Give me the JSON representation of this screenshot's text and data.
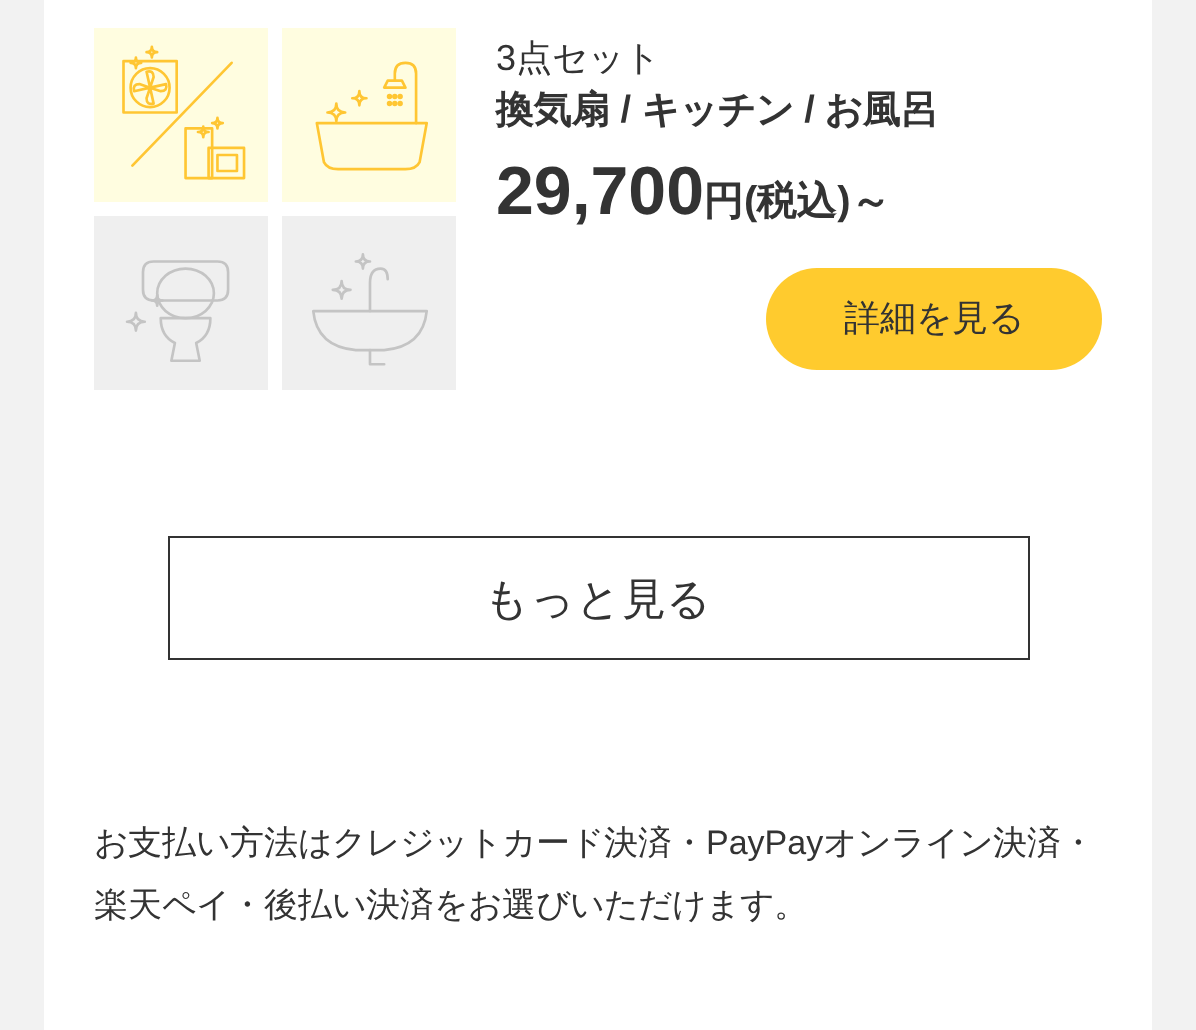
{
  "plan": {
    "tiles": [
      {
        "kind": "fan-kitchen",
        "included": true
      },
      {
        "kind": "bath",
        "included": true
      },
      {
        "kind": "toilet",
        "included": false
      },
      {
        "kind": "sink",
        "included": false
      }
    ],
    "set_label": "3点セット",
    "title": "換気扇 / キッチン / お風呂",
    "price": "29,700",
    "currency": "円",
    "tax_note": "(税込)～",
    "detail_button": "詳細を見る"
  },
  "more_button": "もっと見る",
  "payment_note": "お支払い方法はクレジットカード決済・PayPayオンライン決済・楽天ペイ・後払い決済をお選びいただけます。"
}
